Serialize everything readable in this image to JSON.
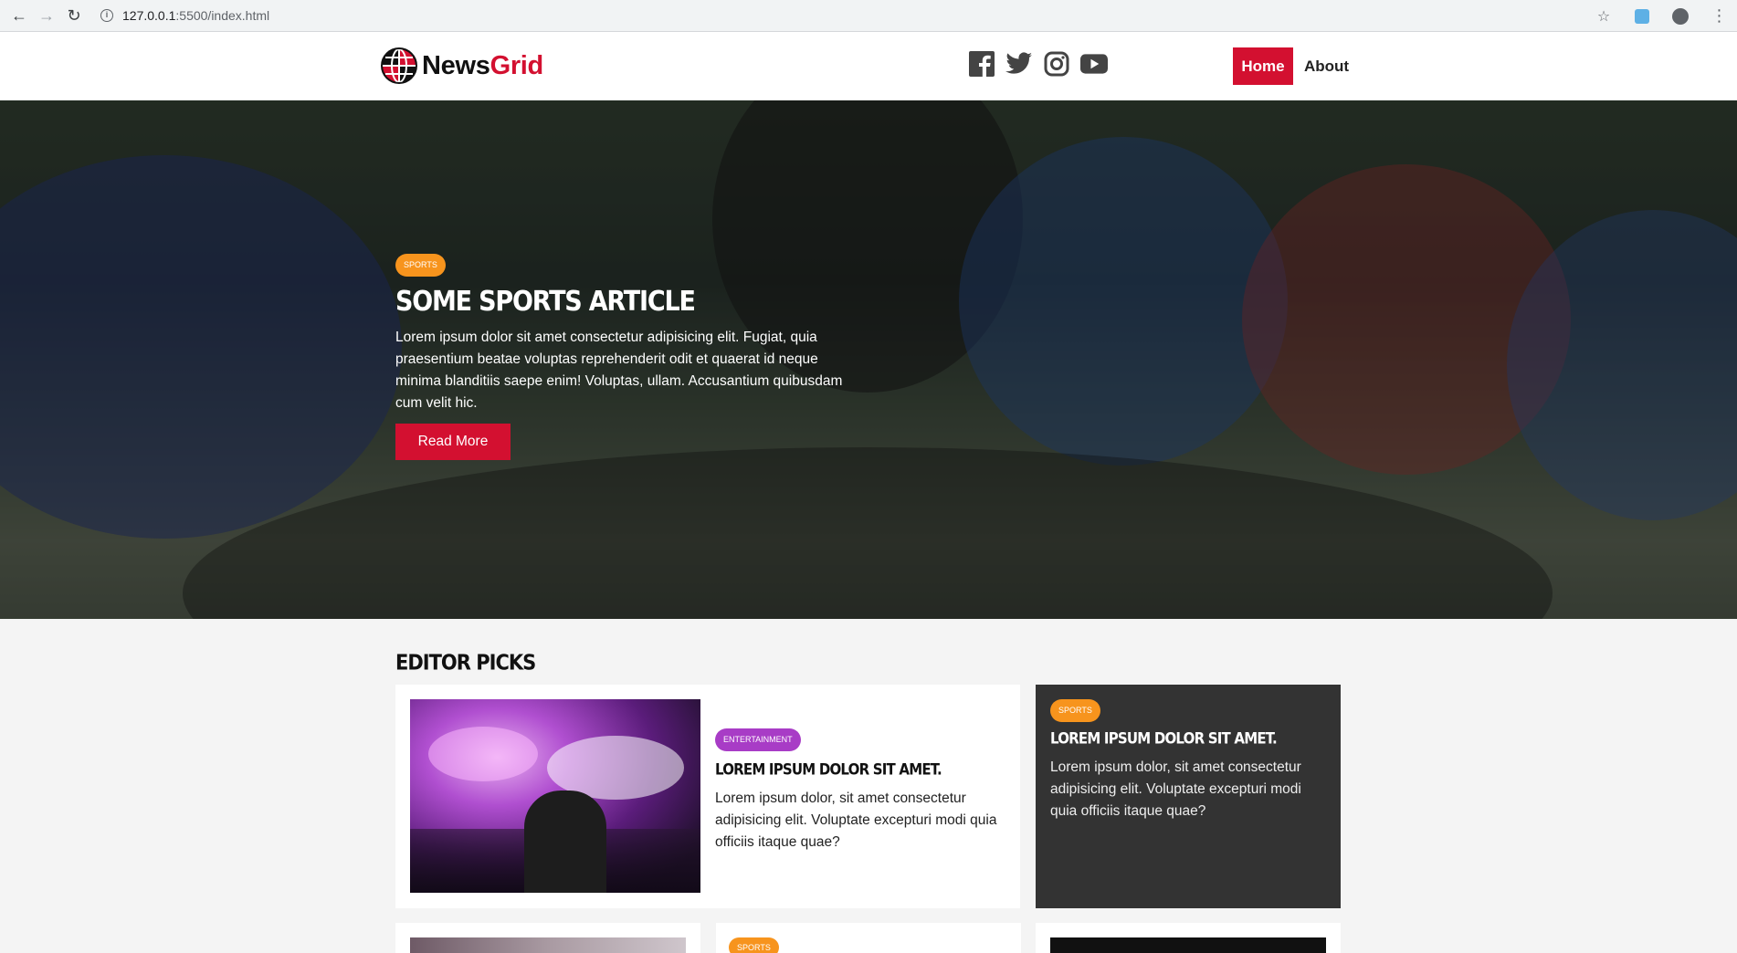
{
  "browser": {
    "url_host": "127.0.0.1",
    "url_path": ":5500/index.html"
  },
  "header": {
    "logo_news": "News",
    "logo_grid": "Grid",
    "socials": [
      "facebook-icon",
      "twitter-icon",
      "instagram-icon",
      "youtube-icon"
    ],
    "nav": {
      "home": "Home",
      "about": "About"
    }
  },
  "hero": {
    "tag": "Sports",
    "title": "Some Sports Article",
    "text": "Lorem ipsum dolor sit amet consectetur adipisicing elit. Fugiat, quia praesentium beatae voluptas reprehenderit odit et quaerat id neque minima blanditiis saepe enim! Voluptas, ullam. Accusantium quibusdam cum velit hic.",
    "button": "Read More"
  },
  "editor_picks": {
    "title": "Editor Picks",
    "main_card": {
      "tag": "Entertainment",
      "title": "Lorem ipsum dolor sit amet.",
      "text": "Lorem ipsum dolor, sit amet consectetur adipisicing elit. Voluptate excepturi modi quia officiis itaque quae?"
    },
    "side_card": {
      "tag": "Sports",
      "title": "Lorem ipsum dolor sit amet.",
      "text": "Lorem ipsum dolor, sit amet consectetur adipisicing elit. Voluptate excepturi modi quia officiis itaque quae?"
    },
    "row2_tag": "Sports"
  },
  "colors": {
    "brand_red": "#d31030",
    "sports_tag": "#f7941d",
    "entertainment_tag": "#a83cc6",
    "dark_card": "#333333"
  }
}
